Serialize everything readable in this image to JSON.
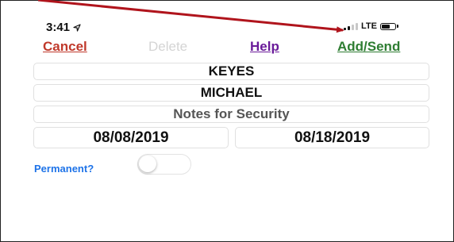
{
  "status_bar": {
    "time": "3:41",
    "network": "LTE",
    "location_icon": "location-arrow-icon",
    "signal_icon": "cell-signal-icon",
    "battery_icon": "battery-icon"
  },
  "nav": {
    "cancel": "Cancel",
    "delete": "Delete",
    "help": "Help",
    "add_send": "Add/Send"
  },
  "form": {
    "last_name": "KEYES",
    "first_name": "MICHAEL",
    "notes_placeholder": "Notes for Security",
    "start_date": "08/08/2019",
    "end_date": "08/18/2019",
    "permanent_label": "Permanent?",
    "permanent": false
  },
  "colors": {
    "cancel": "#c0392b",
    "delete_disabled": "#d4d4d4",
    "help": "#6a1b9a",
    "add_send": "#2e7d32",
    "permanent_label": "#1e73e8",
    "annotation_arrow": "#b0141c"
  }
}
